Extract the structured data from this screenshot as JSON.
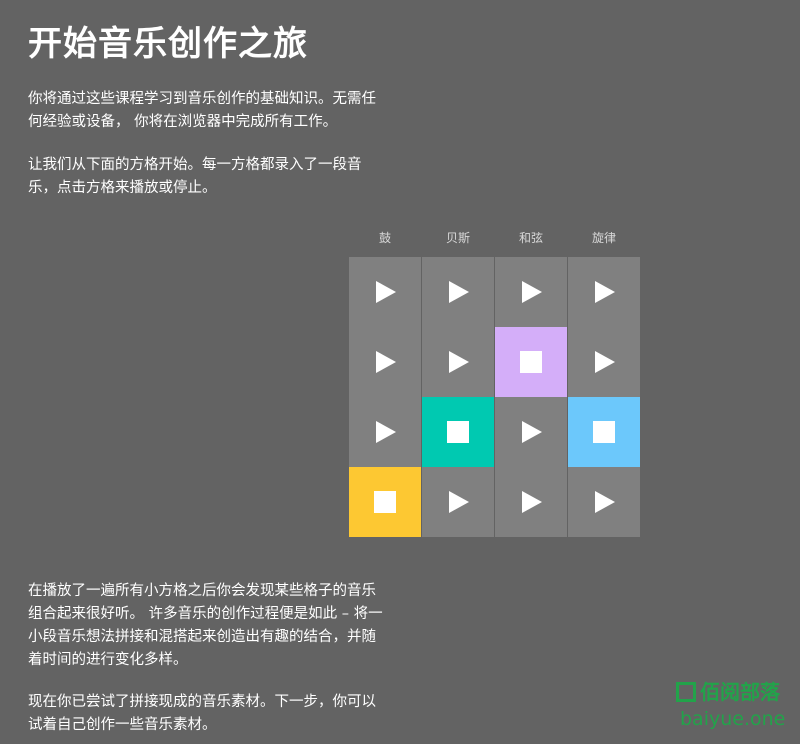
{
  "page": {
    "title": "开始音乐创作之旅",
    "intro_1": "你将通过这些课程学习到音乐创作的基础知识。无需任何经验或设备， 你将在浏览器中完成所有工作。",
    "intro_2": "让我们从下面的方格开始。每一方格都录入了一段音乐，点击方格来播放或停止。",
    "outro_1": "在播放了一遍所有小方格之后你会发现某些格子的音乐组合起来很好听。 许多音乐的创作过程便是如此 – 将一小段音乐想法拼接和混搭起来创造出有趣的结合，并随着时间的进行变化多样。",
    "outro_2": "现在你已尝试了拼接现成的音乐素材。下一步，你可以试着自己创作一些音乐素材。"
  },
  "grid": {
    "columns": [
      "鼓",
      "贝斯",
      "和弦",
      "旋律"
    ],
    "default_color": "#808080",
    "play_icon": "play-icon",
    "stop_icon": "stop-icon",
    "rows": [
      [
        {
          "state": "stopped",
          "color": "#808080"
        },
        {
          "state": "stopped",
          "color": "#808080"
        },
        {
          "state": "stopped",
          "color": "#808080"
        },
        {
          "state": "stopped",
          "color": "#808080"
        }
      ],
      [
        {
          "state": "stopped",
          "color": "#808080"
        },
        {
          "state": "stopped",
          "color": "#808080"
        },
        {
          "state": "playing",
          "color": "#d4aef9"
        },
        {
          "state": "stopped",
          "color": "#808080"
        }
      ],
      [
        {
          "state": "stopped",
          "color": "#808080"
        },
        {
          "state": "playing",
          "color": "#00c9b1"
        },
        {
          "state": "stopped",
          "color": "#808080"
        },
        {
          "state": "playing",
          "color": "#6cc8fb"
        }
      ],
      [
        {
          "state": "playing",
          "color": "#fdc832"
        },
        {
          "state": "stopped",
          "color": "#808080"
        },
        {
          "state": "stopped",
          "color": "#808080"
        },
        {
          "state": "stopped",
          "color": "#808080"
        }
      ]
    ]
  },
  "watermark": {
    "brand_cn": "佰阅部落",
    "brand_en": "baiyue.one",
    "color": "#22a34a"
  }
}
